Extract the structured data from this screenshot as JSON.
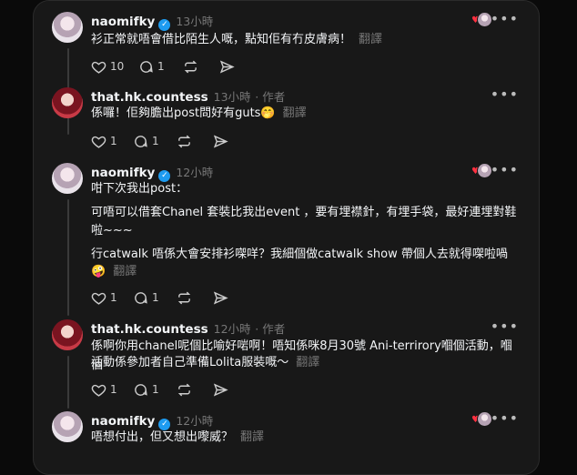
{
  "posts": [
    {
      "username": "naomifky",
      "time": "13小時",
      "lines": [
        "衫正常就唔會借比陌生人嘅，點知佢有冇皮膚病！"
      ],
      "translate": "翻譯",
      "likes": "10",
      "replies": "1"
    },
    {
      "username": "that.hk.countess",
      "time": "13小時",
      "author_tag": "· 作者",
      "lines": [
        "係囉！佢夠膽出post問好有guts🤭"
      ],
      "translate": "翻譯",
      "likes": "1",
      "replies": "1"
    },
    {
      "username": "naomifky",
      "time": "12小時",
      "lines": [
        "咁下次我出post：",
        "可唔可以借套Chanel 套裝比我出event ，要有埋襟針，有埋手袋，最好連埋對鞋",
        "啦~~~",
        "行catwalk 唔係大會安排衫㗎咩？我細個做catwalk show 帶個人去就得㗎啦喎",
        "🤪"
      ],
      "translate": "翻譯",
      "likes": "1",
      "replies": "1"
    },
    {
      "username": "that.hk.countess",
      "time": "12小時",
      "author_tag": "· 作者",
      "lines": [
        "係啊你用chanel呢個比喻好啱啊！唔知係咪8月30號 Ani-terrirory嗰個活動，嗰個",
        "活動係參加者自己準備Lolita服裝嘅～"
      ],
      "translate": "翻譯",
      "likes": "1",
      "replies": "1"
    },
    {
      "username": "naomifky",
      "time": "12小時",
      "lines": [
        "唔想付出，但又想出嚟威？"
      ],
      "translate": "翻譯"
    }
  ],
  "icons": {
    "like": "heart-outline-icon",
    "reply": "speech-bubble-icon",
    "repost": "repost-arrows-icon",
    "share": "send-plane-icon",
    "more": "more-dots-icon",
    "verified": "verified-check-icon"
  },
  "colors": {
    "background": "#181818",
    "verified": "#1d9bf0",
    "liked": "#ff3040"
  }
}
